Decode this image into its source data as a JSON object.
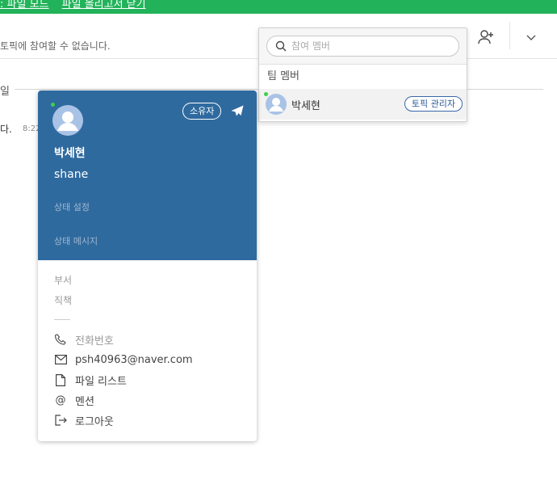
{
  "topbar": {
    "link_1": ": 파일 모드",
    "link_2": "파일 올리고서 닫기"
  },
  "header": {
    "notice": "토픽에 참여할 수 없습니다."
  },
  "timeline": {
    "day_label": "일",
    "message_fragment": "다.",
    "message_time": "8:22"
  },
  "members_panel": {
    "search_placeholder": "참여 멤버",
    "section_title": "팀 멤버",
    "members": [
      {
        "name": "박세현",
        "role_badge": "토픽 관리자"
      }
    ]
  },
  "profile": {
    "owner_badge": "소유자",
    "name": "박세현",
    "id": "shane",
    "status_set": "상태 설정",
    "status_message": "상태 메시지",
    "department": "부서",
    "job_title": "직책",
    "phone": "전화번호",
    "email": "psh40963@naver.com",
    "file_list": "파일 리스트",
    "mention": "멘션",
    "logout": "로그아웃"
  },
  "colors": {
    "topbar": "#22b35a",
    "profile_header": "#2f6a9f",
    "online": "#3ccf4e",
    "badge": "#2d5a9a"
  },
  "icons": [
    "add-member-icon",
    "chevron-down-icon",
    "search-icon",
    "airplane-icon",
    "phone-icon",
    "mail-icon",
    "file-icon",
    "at-icon",
    "logout-icon"
  ]
}
